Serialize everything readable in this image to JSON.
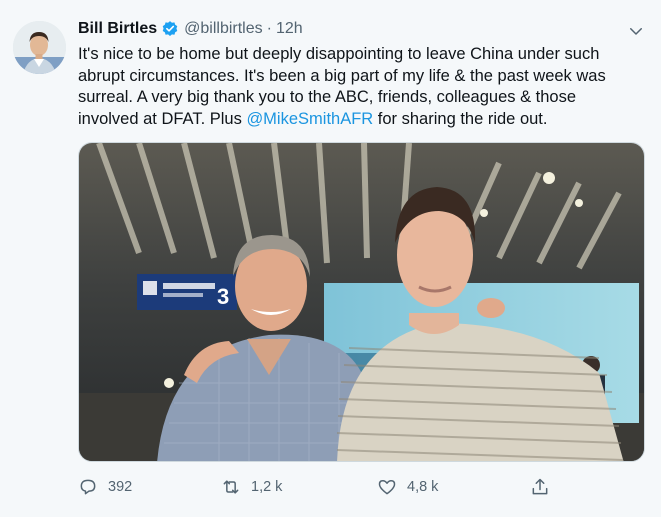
{
  "tweet": {
    "author_name": "Bill Birtles",
    "handle": "@billbirtles",
    "separator": "·",
    "time": "12h",
    "text_before_mention": "It's nice to be home but deeply disappointing to leave China under such abrupt circumstances. It's been a big part of my life & the past week was surreal. A very big thank you to the ABC, friends, colleagues & those involved at DFAT. Plus ",
    "mention": "@MikeSmithAFR",
    "text_after_mention": " for sharing the ride out.",
    "media_sign_text": "3",
    "icons": {
      "verified": "verified-badge-icon",
      "more": "chevron-down-icon",
      "reply": "reply-icon",
      "retweet": "retweet-icon",
      "like": "heart-icon",
      "share": "share-icon"
    },
    "actions": {
      "replies": "392",
      "retweets": "1,2 k",
      "likes": "4,8 k"
    },
    "colors": {
      "accent": "#1da1f2",
      "mention": "#1b95e0",
      "secondary_text": "#536471"
    }
  }
}
